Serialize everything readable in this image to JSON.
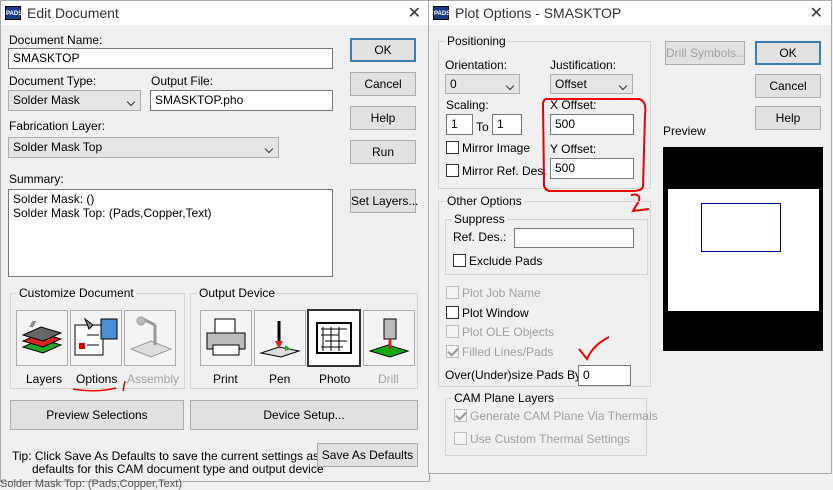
{
  "edit": {
    "title": "Edit Document",
    "icon": "PADS",
    "doc_name_label": "Document Name:",
    "doc_name": "SMASKTOP",
    "doc_type_label": "Document Type:",
    "doc_type": "Solder Mask",
    "output_file_label": "Output File:",
    "output_file": "SMASKTOP.pho",
    "fab_layer_label": "Fabrication Layer:",
    "fab_layer": "Solder Mask Top",
    "summary_label": "Summary:",
    "summary_line1": "Solder Mask: ()",
    "summary_line2": "Solder Mask Top: (Pads,Copper,Text)",
    "ok": "OK",
    "cancel": "Cancel",
    "help": "Help",
    "run": "Run",
    "set_layers": "Set Layers...",
    "customize_label": "Customize Document",
    "output_device_label": "Output Device",
    "layers": "Layers",
    "options": "Options",
    "assembly": "Assembly",
    "print": "Print",
    "pen": "Pen",
    "photo": "Photo",
    "drill": "Drill",
    "preview_sel": "Preview Selections",
    "device_setup": "Device Setup...",
    "tip1": "Tip: Click Save As Defaults to save the current settings as the",
    "tip2": "defaults for this CAM document type and output device",
    "save_defaults": "Save As Defaults",
    "underlay": "Solder Mask Top: (Pads,Copper,Text)"
  },
  "plot": {
    "title": "Plot Options - SMASKTOP",
    "icon": "PADS",
    "positioning": "Positioning",
    "orientation_label": "Orientation:",
    "orientation": "0",
    "justification_label": "Justification:",
    "justification": "Offset",
    "scaling_label": "Scaling:",
    "scale_a": "1",
    "to": "To",
    "scale_b": "1",
    "x_offset_label": "X Offset:",
    "x_offset": "500",
    "y_offset_label": "Y Offset:",
    "y_offset": "500",
    "mirror_image": "Mirror Image",
    "mirror_ref": "Mirror Ref. Des.",
    "other_options": "Other Options",
    "suppress": "Suppress",
    "ref_des_label": "Ref. Des.:",
    "ref_des": "",
    "exclude_pads": "Exclude Pads",
    "plot_job_name": "Plot Job Name",
    "plot_window": "Plot Window",
    "plot_ole": "Plot OLE Objects",
    "filled_lines": "Filled Lines/Pads",
    "oversize_label": "Over(Under)size Pads By:",
    "oversize": "0",
    "cam_plane": "CAM Plane Layers",
    "gen_cam": "Generate CAM Plane Via Thermals",
    "use_custom": "Use Custom Thermal Settings",
    "drill_symbols": "Drill Symbols...",
    "ok": "OK",
    "cancel": "Cancel",
    "help": "Help",
    "preview": "Preview",
    "annot_1": "1",
    "annot_2": "2"
  },
  "colors": {
    "annotation": "#e00000",
    "default_border": "#3c7fb1",
    "preview_bg": "#000000"
  }
}
